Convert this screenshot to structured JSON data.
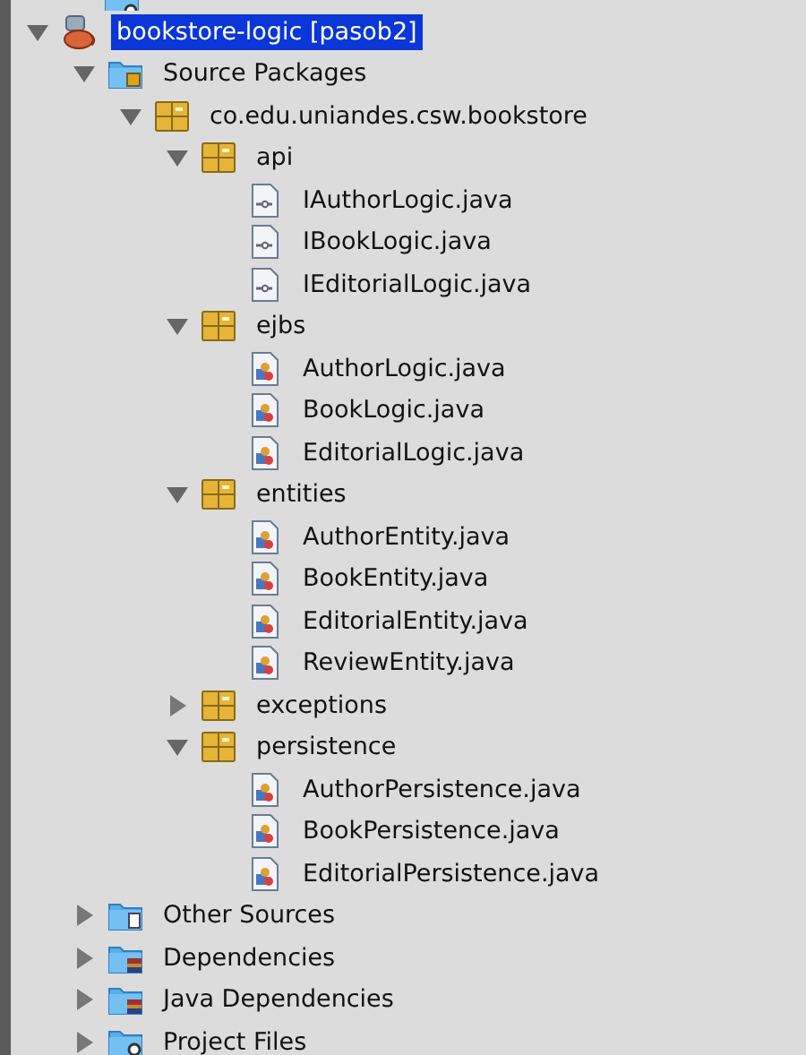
{
  "tree": [
    {
      "label": "bookstore-logic [pasob2]",
      "kind": "project",
      "expanded": true,
      "selected": true,
      "children": [
        {
          "label": "Source Packages",
          "kind": "source-root",
          "expanded": true,
          "selected": false,
          "children": [
            {
              "label": "co.edu.uniandes.csw.bookstore",
              "kind": "package",
              "expanded": true,
              "selected": false,
              "children": [
                {
                  "label": "api",
                  "kind": "package",
                  "expanded": true,
                  "selected": false,
                  "children": [
                    {
                      "label": "IAuthorLogic.java",
                      "kind": "interface",
                      "selected": false
                    },
                    {
                      "label": "IBookLogic.java",
                      "kind": "interface",
                      "selected": false
                    },
                    {
                      "label": "IEditorialLogic.java",
                      "kind": "interface",
                      "selected": false
                    }
                  ]
                },
                {
                  "label": "ejbs",
                  "kind": "package",
                  "expanded": true,
                  "selected": false,
                  "children": [
                    {
                      "label": "AuthorLogic.java",
                      "kind": "class",
                      "selected": false
                    },
                    {
                      "label": "BookLogic.java",
                      "kind": "class",
                      "selected": false
                    },
                    {
                      "label": "EditorialLogic.java",
                      "kind": "class",
                      "selected": false
                    }
                  ]
                },
                {
                  "label": "entities",
                  "kind": "package",
                  "expanded": true,
                  "selected": false,
                  "children": [
                    {
                      "label": "AuthorEntity.java",
                      "kind": "class",
                      "selected": false
                    },
                    {
                      "label": "BookEntity.java",
                      "kind": "class",
                      "selected": false
                    },
                    {
                      "label": "EditorialEntity.java",
                      "kind": "class",
                      "selected": false
                    },
                    {
                      "label": "ReviewEntity.java",
                      "kind": "class",
                      "selected": false
                    }
                  ]
                },
                {
                  "label": "exceptions",
                  "kind": "package",
                  "expanded": false,
                  "selected": false
                },
                {
                  "label": "persistence",
                  "kind": "package",
                  "expanded": true,
                  "selected": false,
                  "children": [
                    {
                      "label": "AuthorPersistence.java",
                      "kind": "class",
                      "selected": false
                    },
                    {
                      "label": "BookPersistence.java",
                      "kind": "class",
                      "selected": false
                    },
                    {
                      "label": "EditorialPersistence.java",
                      "kind": "class",
                      "selected": false
                    }
                  ]
                }
              ]
            }
          ]
        },
        {
          "label": "Other Sources",
          "kind": "other-sources",
          "expanded": false,
          "selected": false
        },
        {
          "label": "Dependencies",
          "kind": "dependencies",
          "expanded": false,
          "selected": false
        },
        {
          "label": "Java Dependencies",
          "kind": "dependencies",
          "expanded": false,
          "selected": false
        },
        {
          "label": "Project Files",
          "kind": "project-files",
          "expanded": false,
          "selected": false
        }
      ]
    }
  ]
}
